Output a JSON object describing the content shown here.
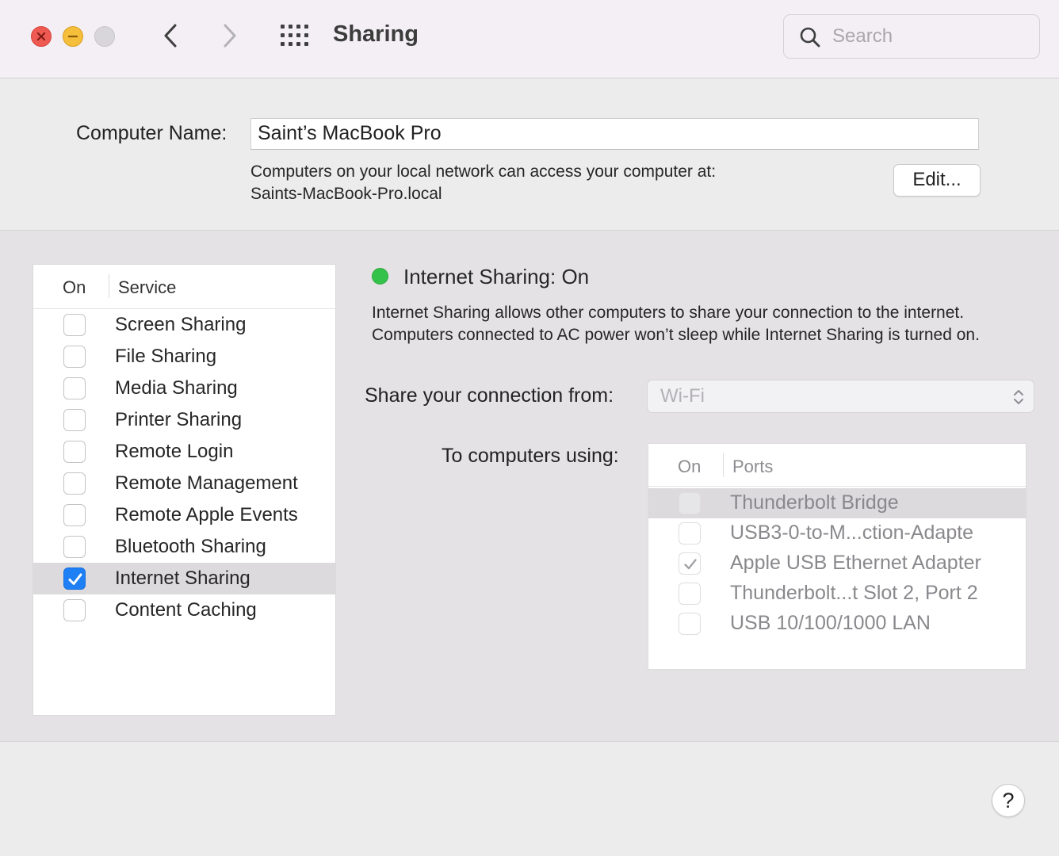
{
  "window": {
    "title": "Sharing",
    "search": {
      "placeholder": "Search",
      "value": ""
    }
  },
  "computer_name": {
    "label": "Computer Name:",
    "value": "Saint’s MacBook Pro",
    "description_line1": "Computers on your local network can access your computer at:",
    "description_line2": "Saints-MacBook-Pro.local",
    "edit_label": "Edit..."
  },
  "services": {
    "header_on": "On",
    "header_service": "Service",
    "items": [
      {
        "label": "Screen Sharing",
        "checked": false
      },
      {
        "label": "File Sharing",
        "checked": false
      },
      {
        "label": "Media Sharing",
        "checked": false
      },
      {
        "label": "Printer Sharing",
        "checked": false
      },
      {
        "label": "Remote Login",
        "checked": false
      },
      {
        "label": "Remote Management",
        "checked": false
      },
      {
        "label": "Remote Apple Events",
        "checked": false
      },
      {
        "label": "Bluetooth Sharing",
        "checked": false
      },
      {
        "label": "Internet Sharing",
        "checked": true,
        "selected": true
      },
      {
        "label": "Content Caching",
        "checked": false
      }
    ]
  },
  "detail": {
    "status_title": "Internet Sharing: On",
    "status_color": "#35c24a",
    "description": "Internet Sharing allows other computers to share your connection to the internet. Computers connected to AC power won’t sleep while Internet Sharing is turned on.",
    "share_from_label": "Share your connection from:",
    "share_from_value": "Wi-Fi",
    "to_computers_label": "To computers using:",
    "ports_header_on": "On",
    "ports_header_ports": "Ports",
    "ports": [
      {
        "label": "Thunderbolt Bridge",
        "checked": false,
        "selected": true
      },
      {
        "label": "USB3-0-to-M...ction-Adapte",
        "checked": false
      },
      {
        "label": "Apple USB Ethernet Adapter",
        "checked": true
      },
      {
        "label": "Thunderbolt...t Slot 2, Port 2",
        "checked": false
      },
      {
        "label": "USB 10/100/1000 LAN",
        "checked": false
      }
    ]
  },
  "help_label": "?",
  "colors": {
    "accent": "#1f7ff5",
    "close": "#ee5a52",
    "minimize": "#f5be3b"
  }
}
